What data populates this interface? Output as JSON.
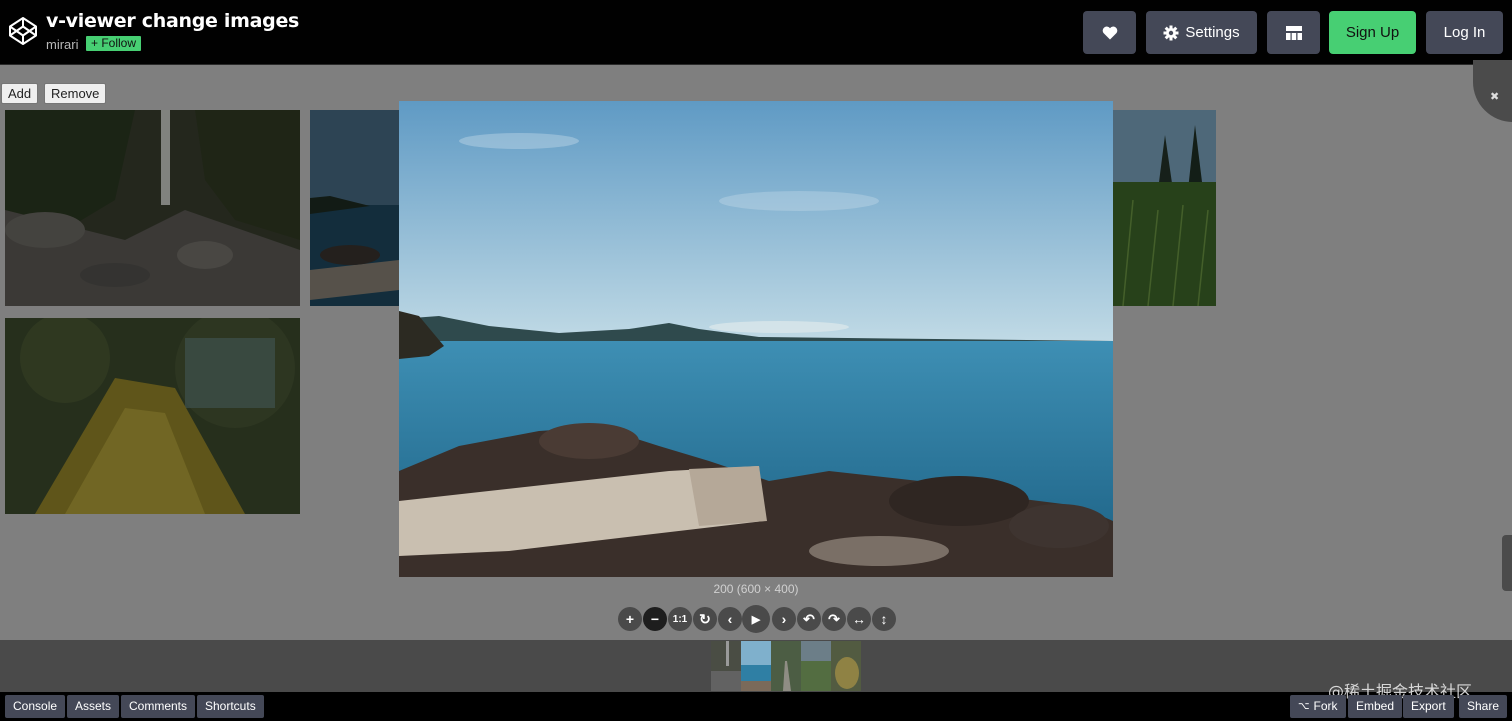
{
  "header": {
    "title": "v-viewer change images",
    "author": "mirari",
    "follow_label": "+ Follow",
    "settings_label": "Settings",
    "signup_label": "Sign Up",
    "login_label": "Log In"
  },
  "toolbar": {
    "add_label": "Add",
    "remove_label": "Remove"
  },
  "viewer": {
    "caption": "200 (600 × 400)",
    "controls": [
      "zoom-in",
      "zoom-out",
      "one-to-one",
      "reset",
      "prev",
      "play",
      "next",
      "rotate-left",
      "rotate-right",
      "flip-horizontal",
      "flip-vertical"
    ],
    "one_to_one_label": "1:1",
    "thumbnail_count": 5,
    "active_thumbnail": 2
  },
  "footer": {
    "console_label": "Console",
    "assets_label": "Assets",
    "comments_label": "Comments",
    "shortcuts_label": "Shortcuts",
    "fork_label": "Fork",
    "embed_label": "Embed",
    "export_label": "Export",
    "share_label": "Share"
  },
  "watermark": "@稀土掘金技术社区",
  "colors": {
    "header_bg": "#010101",
    "button_bg": "#444857",
    "accent_green": "#47cf73",
    "overlay_bg": "#7f7f7f"
  }
}
